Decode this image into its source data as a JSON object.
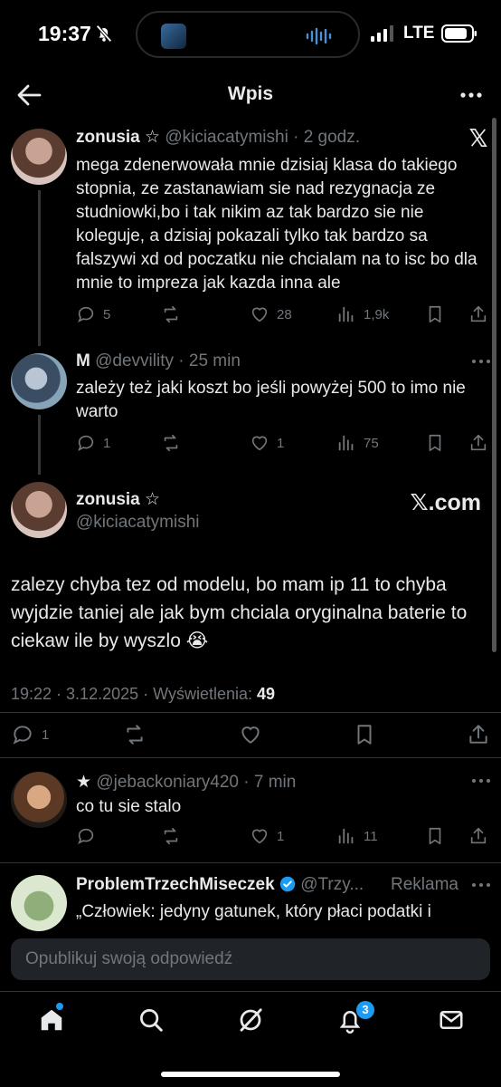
{
  "status_bar": {
    "time": "19:37",
    "network": "LTE"
  },
  "header": {
    "title": "Wpis"
  },
  "tweets": [
    {
      "name": "zonusia ☆",
      "handle": "@kiciacatymishi",
      "time": "· 2 godz.",
      "text": "mega zdenerwowała mnie dzisiaj klasa do takiego stopnia, ze zastanawiam sie nad rezygnacja ze studniowki,bo i tak nikim az tak bardzo sie nie koleguje, a dzisiaj pokazali tylko tak bardzo sa falszywi xd od poczatku nie chcialam na to isc bo dla mnie to impreza jak kazda inna ale",
      "replies": "5",
      "likes": "28",
      "views": "1,9k"
    },
    {
      "name": "M",
      "handle": "@devvility",
      "time": "· 25 min",
      "text": "zależy też jaki koszt bo jeśli powyżej 500 to imo nie warto",
      "replies": "1",
      "likes": "1",
      "views": "75"
    }
  ],
  "main_tweet": {
    "name": "zonusia ☆",
    "handle": "@kiciacatymishi",
    "watermark": "𝕏.com",
    "text": "zalezy chyba tez od modelu, bo mam ip 11 to chyba wyjdzie taniej ale jak bym chciala oryginalna baterie to ciekaw ile by wyszlo 😭",
    "timestamp": "19:22 · 3.12.2025 · Wyświetlenia:",
    "views": "49",
    "replies": "1"
  },
  "reply": {
    "name": "★",
    "handle": "@jebackoniary420",
    "time": "· 7 min",
    "text": "co tu sie stalo",
    "likes": "1",
    "views": "11"
  },
  "ad": {
    "name": "ProblemTrzechMiseczek",
    "handle": "@Trzy...",
    "label": "Reklama",
    "text": "„Człowiek: jedyny gatunek, który płaci podatki i"
  },
  "reply_bar": {
    "placeholder": "Opublikuj swoją odpowiedź"
  },
  "nav": {
    "notifications_badge": "3"
  }
}
